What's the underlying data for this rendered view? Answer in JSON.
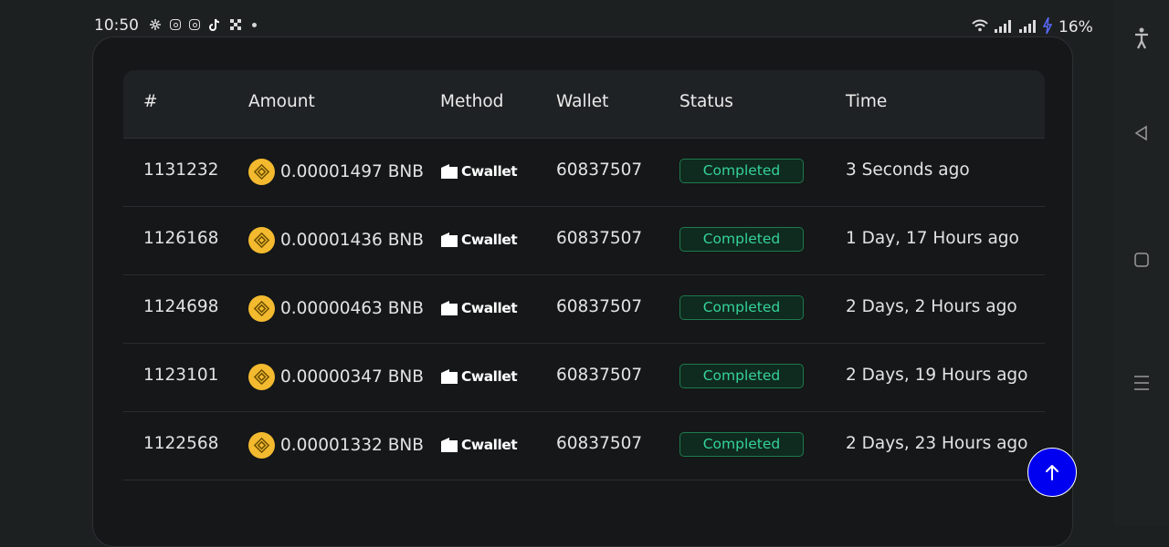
{
  "status_bar": {
    "time": "10:50",
    "notification_icons": [
      "pinwheel-icon",
      "instagram-icon",
      "instagram-icon",
      "tiktok-icon",
      "app-x-icon",
      "dot-icon"
    ],
    "battery": "16%"
  },
  "table": {
    "headers": {
      "id": "#",
      "amount": "Amount",
      "method": "Method",
      "wallet": "Wallet",
      "status": "Status",
      "time": "Time"
    },
    "rows": [
      {
        "id": "1131232",
        "amount": "0.00001497 BNB",
        "method": "Cwallet",
        "wallet": "60837507",
        "status": "Completed",
        "time": "3 Seconds ago"
      },
      {
        "id": "1126168",
        "amount": "0.00001436 BNB",
        "method": "Cwallet",
        "wallet": "60837507",
        "status": "Completed",
        "time": "1 Day, 17 Hours ago"
      },
      {
        "id": "1124698",
        "amount": "0.00000463 BNB",
        "method": "Cwallet",
        "wallet": "60837507",
        "status": "Completed",
        "time": "2 Days, 2 Hours ago"
      },
      {
        "id": "1123101",
        "amount": "0.00000347 BNB",
        "method": "Cwallet",
        "wallet": "60837507",
        "status": "Completed",
        "time": "2 Days, 19 Hours ago"
      },
      {
        "id": "1122568",
        "amount": "0.00001332 BNB",
        "method": "Cwallet",
        "wallet": "60837507",
        "status": "Completed",
        "time": "2 Days, 23 Hours ago"
      }
    ]
  },
  "colors": {
    "background": "#1d2021",
    "card": "#151718",
    "status_text": "#34d399",
    "bnb": "#f3ba2f",
    "fab": "#0000f0"
  },
  "icons": {
    "coin": "bnb-coin-icon",
    "method": "cwallet-logo-icon",
    "fab": "arrow-up-icon",
    "nav": [
      "accessibility-icon",
      "back-icon",
      "home-icon",
      "recents-icon"
    ]
  }
}
